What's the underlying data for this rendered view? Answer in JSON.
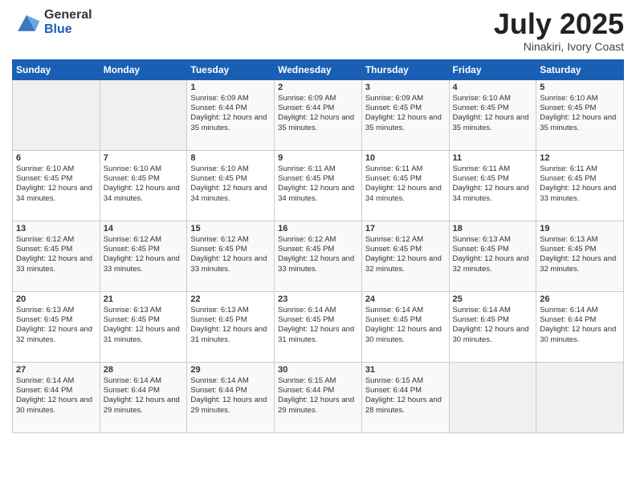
{
  "header": {
    "logo_general": "General",
    "logo_blue": "Blue",
    "title": "July 2025",
    "location": "Ninakiri, Ivory Coast"
  },
  "days_of_week": [
    "Sunday",
    "Monday",
    "Tuesday",
    "Wednesday",
    "Thursday",
    "Friday",
    "Saturday"
  ],
  "weeks": [
    [
      {
        "day": "",
        "sunrise": "",
        "sunset": "",
        "daylight": ""
      },
      {
        "day": "",
        "sunrise": "",
        "sunset": "",
        "daylight": ""
      },
      {
        "day": "1",
        "sunrise": "Sunrise: 6:09 AM",
        "sunset": "Sunset: 6:44 PM",
        "daylight": "Daylight: 12 hours and 35 minutes."
      },
      {
        "day": "2",
        "sunrise": "Sunrise: 6:09 AM",
        "sunset": "Sunset: 6:44 PM",
        "daylight": "Daylight: 12 hours and 35 minutes."
      },
      {
        "day": "3",
        "sunrise": "Sunrise: 6:09 AM",
        "sunset": "Sunset: 6:45 PM",
        "daylight": "Daylight: 12 hours and 35 minutes."
      },
      {
        "day": "4",
        "sunrise": "Sunrise: 6:10 AM",
        "sunset": "Sunset: 6:45 PM",
        "daylight": "Daylight: 12 hours and 35 minutes."
      },
      {
        "day": "5",
        "sunrise": "Sunrise: 6:10 AM",
        "sunset": "Sunset: 6:45 PM",
        "daylight": "Daylight: 12 hours and 35 minutes."
      }
    ],
    [
      {
        "day": "6",
        "sunrise": "Sunrise: 6:10 AM",
        "sunset": "Sunset: 6:45 PM",
        "daylight": "Daylight: 12 hours and 34 minutes."
      },
      {
        "day": "7",
        "sunrise": "Sunrise: 6:10 AM",
        "sunset": "Sunset: 6:45 PM",
        "daylight": "Daylight: 12 hours and 34 minutes."
      },
      {
        "day": "8",
        "sunrise": "Sunrise: 6:10 AM",
        "sunset": "Sunset: 6:45 PM",
        "daylight": "Daylight: 12 hours and 34 minutes."
      },
      {
        "day": "9",
        "sunrise": "Sunrise: 6:11 AM",
        "sunset": "Sunset: 6:45 PM",
        "daylight": "Daylight: 12 hours and 34 minutes."
      },
      {
        "day": "10",
        "sunrise": "Sunrise: 6:11 AM",
        "sunset": "Sunset: 6:45 PM",
        "daylight": "Daylight: 12 hours and 34 minutes."
      },
      {
        "day": "11",
        "sunrise": "Sunrise: 6:11 AM",
        "sunset": "Sunset: 6:45 PM",
        "daylight": "Daylight: 12 hours and 34 minutes."
      },
      {
        "day": "12",
        "sunrise": "Sunrise: 6:11 AM",
        "sunset": "Sunset: 6:45 PM",
        "daylight": "Daylight: 12 hours and 33 minutes."
      }
    ],
    [
      {
        "day": "13",
        "sunrise": "Sunrise: 6:12 AM",
        "sunset": "Sunset: 6:45 PM",
        "daylight": "Daylight: 12 hours and 33 minutes."
      },
      {
        "day": "14",
        "sunrise": "Sunrise: 6:12 AM",
        "sunset": "Sunset: 6:45 PM",
        "daylight": "Daylight: 12 hours and 33 minutes."
      },
      {
        "day": "15",
        "sunrise": "Sunrise: 6:12 AM",
        "sunset": "Sunset: 6:45 PM",
        "daylight": "Daylight: 12 hours and 33 minutes."
      },
      {
        "day": "16",
        "sunrise": "Sunrise: 6:12 AM",
        "sunset": "Sunset: 6:45 PM",
        "daylight": "Daylight: 12 hours and 33 minutes."
      },
      {
        "day": "17",
        "sunrise": "Sunrise: 6:12 AM",
        "sunset": "Sunset: 6:45 PM",
        "daylight": "Daylight: 12 hours and 32 minutes."
      },
      {
        "day": "18",
        "sunrise": "Sunrise: 6:13 AM",
        "sunset": "Sunset: 6:45 PM",
        "daylight": "Daylight: 12 hours and 32 minutes."
      },
      {
        "day": "19",
        "sunrise": "Sunrise: 6:13 AM",
        "sunset": "Sunset: 6:45 PM",
        "daylight": "Daylight: 12 hours and 32 minutes."
      }
    ],
    [
      {
        "day": "20",
        "sunrise": "Sunrise: 6:13 AM",
        "sunset": "Sunset: 6:45 PM",
        "daylight": "Daylight: 12 hours and 32 minutes."
      },
      {
        "day": "21",
        "sunrise": "Sunrise: 6:13 AM",
        "sunset": "Sunset: 6:45 PM",
        "daylight": "Daylight: 12 hours and 31 minutes."
      },
      {
        "day": "22",
        "sunrise": "Sunrise: 6:13 AM",
        "sunset": "Sunset: 6:45 PM",
        "daylight": "Daylight: 12 hours and 31 minutes."
      },
      {
        "day": "23",
        "sunrise": "Sunrise: 6:14 AM",
        "sunset": "Sunset: 6:45 PM",
        "daylight": "Daylight: 12 hours and 31 minutes."
      },
      {
        "day": "24",
        "sunrise": "Sunrise: 6:14 AM",
        "sunset": "Sunset: 6:45 PM",
        "daylight": "Daylight: 12 hours and 30 minutes."
      },
      {
        "day": "25",
        "sunrise": "Sunrise: 6:14 AM",
        "sunset": "Sunset: 6:45 PM",
        "daylight": "Daylight: 12 hours and 30 minutes."
      },
      {
        "day": "26",
        "sunrise": "Sunrise: 6:14 AM",
        "sunset": "Sunset: 6:44 PM",
        "daylight": "Daylight: 12 hours and 30 minutes."
      }
    ],
    [
      {
        "day": "27",
        "sunrise": "Sunrise: 6:14 AM",
        "sunset": "Sunset: 6:44 PM",
        "daylight": "Daylight: 12 hours and 30 minutes."
      },
      {
        "day": "28",
        "sunrise": "Sunrise: 6:14 AM",
        "sunset": "Sunset: 6:44 PM",
        "daylight": "Daylight: 12 hours and 29 minutes."
      },
      {
        "day": "29",
        "sunrise": "Sunrise: 6:14 AM",
        "sunset": "Sunset: 6:44 PM",
        "daylight": "Daylight: 12 hours and 29 minutes."
      },
      {
        "day": "30",
        "sunrise": "Sunrise: 6:15 AM",
        "sunset": "Sunset: 6:44 PM",
        "daylight": "Daylight: 12 hours and 29 minutes."
      },
      {
        "day": "31",
        "sunrise": "Sunrise: 6:15 AM",
        "sunset": "Sunset: 6:44 PM",
        "daylight": "Daylight: 12 hours and 28 minutes."
      },
      {
        "day": "",
        "sunrise": "",
        "sunset": "",
        "daylight": ""
      },
      {
        "day": "",
        "sunrise": "",
        "sunset": "",
        "daylight": ""
      }
    ]
  ]
}
